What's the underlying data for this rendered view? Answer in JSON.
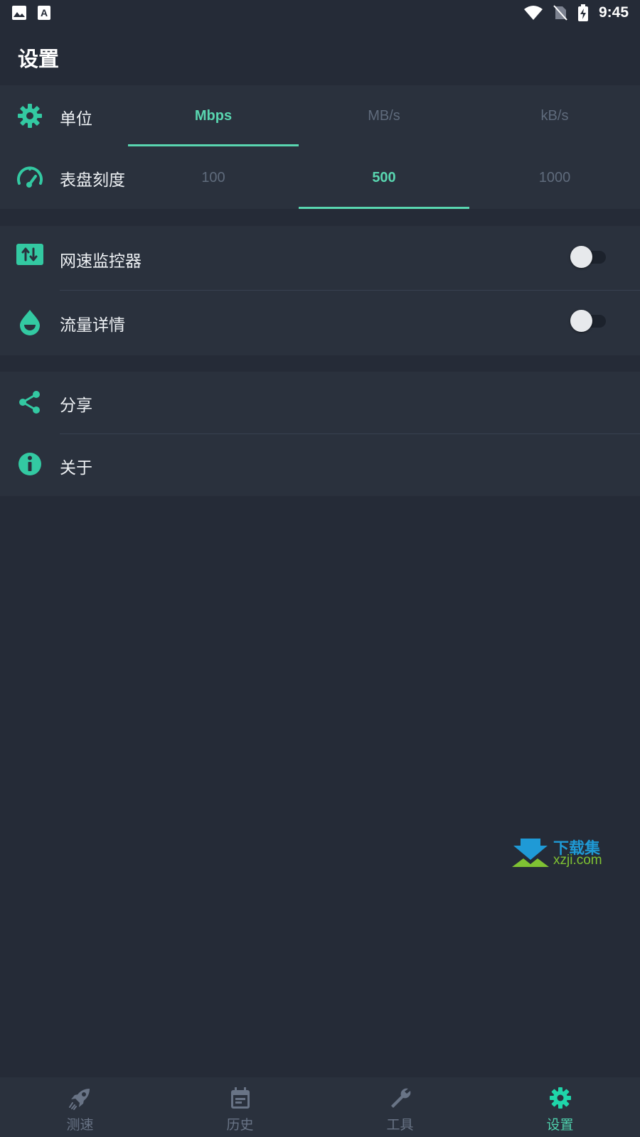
{
  "status_bar": {
    "time": "9:45",
    "icons": [
      "image-icon",
      "text-a-icon",
      "wifi-icon",
      "no-sim-icon",
      "battery-charging-icon"
    ]
  },
  "header": {
    "title": "设置"
  },
  "settings": {
    "unit": {
      "icon": "gear-icon",
      "label": "单位",
      "options": [
        "Mbps",
        "MB/s",
        "kB/s"
      ],
      "selected": "Mbps"
    },
    "dial_scale": {
      "icon": "speedometer-icon",
      "label": "表盘刻度",
      "options": [
        "100",
        "500",
        "1000"
      ],
      "selected": "500"
    },
    "speed_monitor": {
      "icon": "up-down-arrows-icon",
      "label": "网速监控器",
      "enabled": false
    },
    "traffic_details": {
      "icon": "drop-icon",
      "label": "流量详情",
      "enabled": false
    },
    "share": {
      "icon": "share-icon",
      "label": "分享"
    },
    "about": {
      "icon": "info-icon",
      "label": "关于"
    }
  },
  "watermark": {
    "text_cn": "下载集",
    "text_en": "xzji.com"
  },
  "bottom_nav": {
    "items": [
      {
        "icon": "rocket-icon",
        "label": "测速"
      },
      {
        "icon": "calendar-icon",
        "label": "历史"
      },
      {
        "icon": "wrench-icon",
        "label": "工具"
      },
      {
        "icon": "gear-icon",
        "label": "设置"
      }
    ],
    "active": "设置"
  },
  "colors": {
    "background": "#252b37",
    "card": "#2a313d",
    "accent": "#59d6b0",
    "inactive": "#5f6b7c"
  }
}
